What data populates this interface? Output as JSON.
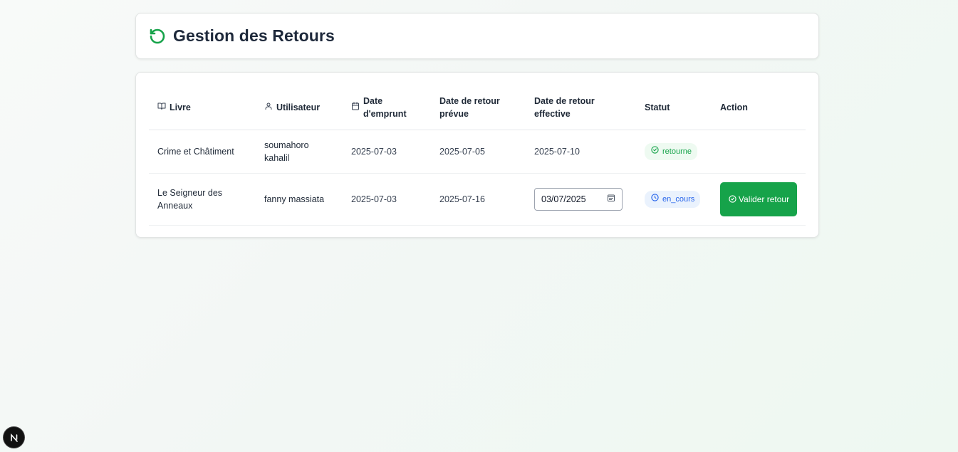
{
  "header": {
    "title": "Gestion des Retours",
    "icon": "refresh-icon"
  },
  "table": {
    "columns": [
      {
        "label": "Livre",
        "icon": "book-icon"
      },
      {
        "label": "Utilisateur",
        "icon": "user-icon"
      },
      {
        "label": "Date d'emprunt",
        "icon": "calendar-icon"
      },
      {
        "label": "Date de retour prévue"
      },
      {
        "label": "Date de retour effective"
      },
      {
        "label": "Statut"
      },
      {
        "label": "Action"
      }
    ],
    "rows": [
      {
        "livre": "Crime et Châtiment",
        "utilisateur": "soumahoro kahalil",
        "date_emprunt": "2025-07-03",
        "date_prevue": "2025-07-05",
        "date_effective": "2025-07-10",
        "statut": "retourne"
      },
      {
        "livre": "Le Seigneur des Anneaux",
        "utilisateur": "fanny massiata",
        "date_emprunt": "2025-07-03",
        "date_prevue": "2025-07-16",
        "date_effective_input": "03/07/2025",
        "statut": "en_cours",
        "action_label": "Valider retour"
      }
    ]
  },
  "colors": {
    "accent": "#16a34a",
    "status_retourne": "#16a34a",
    "status_en_cours": "#2563eb"
  },
  "devtools": {
    "badge_letter": "N"
  }
}
